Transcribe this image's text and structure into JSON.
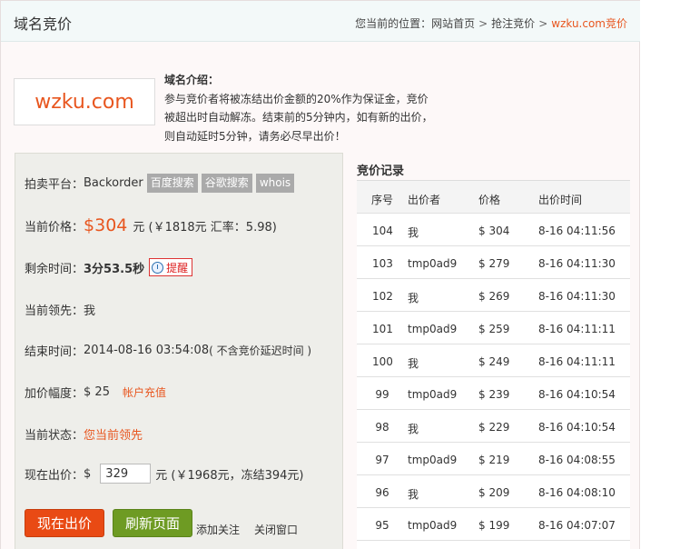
{
  "header": {
    "title": "域名竞价",
    "breadcrumb_prefix": "您当前的位置：",
    "crumbs": [
      "网站首页",
      "抢注竞价"
    ],
    "crumb_separator": ">",
    "current": "wzku.com竞价"
  },
  "domain": {
    "logo_text": "wzku.com"
  },
  "intro": {
    "title": "域名介绍：",
    "lines": [
      "参与竞价者将被冻结出价金额的20%作为保证金，竞价",
      "被超出时自动解冻。结束前的5分钟内，如有新的出价，",
      "则自动延时5分钟，请务必尽早出价！"
    ]
  },
  "info": {
    "platform_label": "拍卖平台：",
    "platform_value": "Backorder",
    "tags": [
      "百度搜索",
      "谷歌搜索",
      "whois"
    ],
    "price_label": "当前价格：",
    "price_value": "$304",
    "price_rmb": "元 (￥1818元  汇率：5.98)",
    "remain_label": "剩余时间：",
    "remain_value": "3分53.5秒",
    "remind_label": "提醒",
    "leader_label": "当前领先：",
    "leader_value": "我",
    "end_label": "结束时间：",
    "end_value": "2014-08-16 03:54:08",
    "end_note": "( 不含竞价延迟时间 )",
    "increment_label": "加价幅度：",
    "increment_value": "$ 25",
    "recharge_link": "帐户充值",
    "status_label": "当前状态：",
    "status_value": "您当前领先",
    "bid_label": "现在出价：",
    "bid_currency": "$",
    "bid_input_value": "329",
    "bid_rmb": "元 (￥1968元，冻结394元)",
    "colors": {
      "accent": "#e8561f",
      "bid_button": "#e94a14",
      "refresh_button": "#6e9b23"
    }
  },
  "actions": {
    "bid_button": "现在出价",
    "refresh_button": "刷新页面",
    "follow_link": "添加关注",
    "close_link": "关闭窗口"
  },
  "records": {
    "title": "竞价记录",
    "columns": [
      "序号",
      "出价者",
      "价格",
      "出价时间"
    ],
    "rows": [
      {
        "no": "104",
        "user": "我",
        "price": "$ 304",
        "time": "8-16 04:11:56"
      },
      {
        "no": "103",
        "user": "tmp0ad9",
        "price": "$ 279",
        "time": "8-16 04:11:30"
      },
      {
        "no": "102",
        "user": "我",
        "price": "$ 269",
        "time": "8-16 04:11:30"
      },
      {
        "no": "101",
        "user": "tmp0ad9",
        "price": "$ 259",
        "time": "8-16 04:11:11"
      },
      {
        "no": "100",
        "user": "我",
        "price": "$ 249",
        "time": "8-16 04:11:11"
      },
      {
        "no": "99",
        "user": "tmp0ad9",
        "price": "$ 239",
        "time": "8-16 04:10:54"
      },
      {
        "no": "98",
        "user": "我",
        "price": "$ 229",
        "time": "8-16 04:10:54"
      },
      {
        "no": "97",
        "user": "tmp0ad9",
        "price": "$ 219",
        "time": "8-16 04:08:55"
      },
      {
        "no": "96",
        "user": "我",
        "price": "$ 209",
        "time": "8-16 04:08:10"
      },
      {
        "no": "95",
        "user": "tmp0ad9",
        "price": "$ 199",
        "time": "8-16 04:07:07"
      }
    ]
  }
}
